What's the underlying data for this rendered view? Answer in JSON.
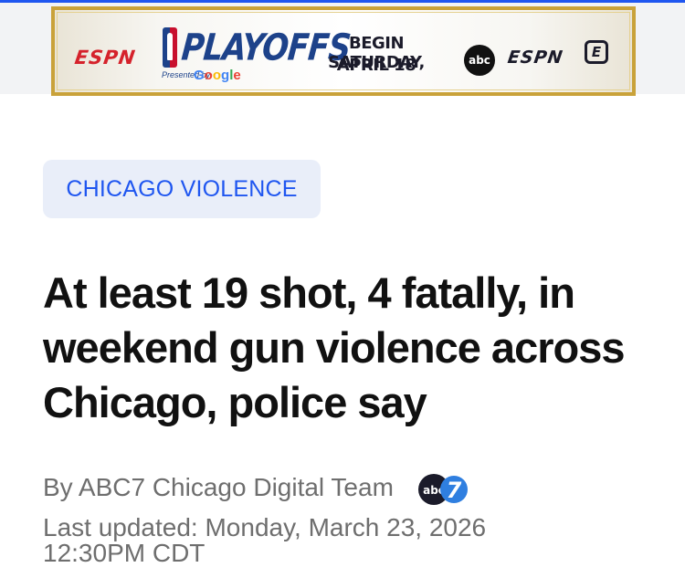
{
  "ad": {
    "espn_logo_text": "ESPN",
    "playoffs_text": "PLAYOFFS",
    "presented_by": "Presented by",
    "google_text": "Google",
    "date_line1": "BEGIN SATURDAY,",
    "date_line2": "APRIL 18",
    "abc_logo_text": "abc",
    "espn_logo_text_2": "ESPN",
    "espn_plus_text": "E"
  },
  "article": {
    "category": "CHICAGO VIOLENCE",
    "headline": "At least 19 shot, 4 fatally, in weekend gun violence across Chicago, police say",
    "byline": "By ABC7 Chicago Digital Team",
    "byline_logo_text": "abc",
    "byline_logo_number": "7",
    "last_updated_line1": "Last updated: Monday, March 23, 2026",
    "last_updated_line2": "12:30PM CDT"
  },
  "colors": {
    "accent_blue": "#1f56f0",
    "pill_background": "#e9eef9",
    "headline_text": "#111111",
    "meta_text": "#6e6e6e",
    "espn_red": "#d5222b",
    "nba_blue": "#1d428a",
    "ad_border_gold": "#c9a23a",
    "abc7_blue": "#2f7fe0"
  }
}
